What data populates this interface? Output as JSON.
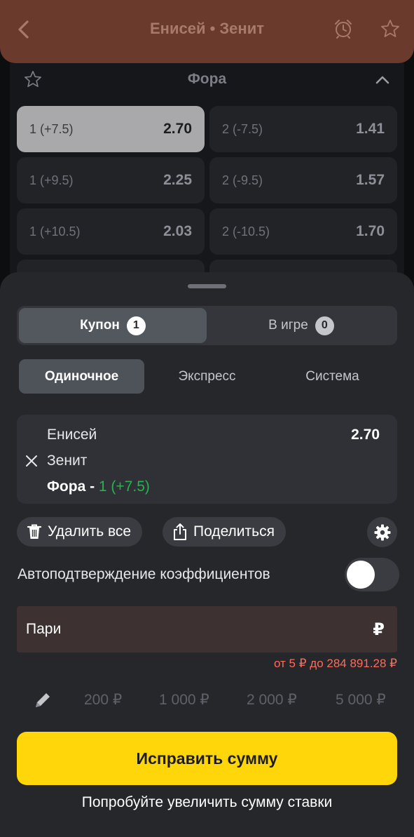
{
  "header": {
    "title": "Енисей • Зенит",
    "icons": [
      "chevron-left-icon",
      "alarm-clock-icon",
      "star-icon"
    ],
    "background": "#6a3a2c"
  },
  "market": {
    "title": "Фора",
    "odds": [
      {
        "label": "1 (+7.5)",
        "value": "2.70",
        "selected": true
      },
      {
        "label": "2 (-7.5)",
        "value": "1.41",
        "selected": false
      },
      {
        "label": "1 (+9.5)",
        "value": "2.25",
        "selected": false
      },
      {
        "label": "2 (-9.5)",
        "value": "1.57",
        "selected": false
      },
      {
        "label": "1 (+10.5)",
        "value": "2.03",
        "selected": false
      },
      {
        "label": "2 (-10.5)",
        "value": "1.70",
        "selected": false
      }
    ]
  },
  "slip": {
    "tabs": [
      {
        "label": "Купон",
        "count": "1",
        "active": true
      },
      {
        "label": "В игре",
        "count": "0",
        "active": false
      }
    ],
    "types": [
      {
        "label": "Одиночное",
        "active": true
      },
      {
        "label": "Экспресс",
        "active": false
      },
      {
        "label": "Система",
        "active": false
      }
    ],
    "bet": {
      "team1": "Енисей",
      "team2": "Зенит",
      "market": "Фора - ",
      "selection": "1 (+7.5)",
      "coefficient": "2.70"
    },
    "actions": {
      "delete_all": "Удалить все",
      "share": "Поделиться"
    },
    "auto_confirm": {
      "label": "Автоподтверждение коэффициентов",
      "enabled": false
    },
    "stake": {
      "placeholder": "Пари",
      "currency": "₽"
    },
    "range": "от 5 ₽ до 284 891.28 ₽",
    "quick_amounts": [
      "200 ₽",
      "1 000 ₽",
      "2 000 ₽",
      "5 000 ₽"
    ],
    "submit": "Исправить сумму",
    "hint": "Попробуйте увеличить сумму ставки",
    "accent_color": "#ffd60a",
    "error_color": "#ff6b5c",
    "selection_color": "#27b34f"
  }
}
